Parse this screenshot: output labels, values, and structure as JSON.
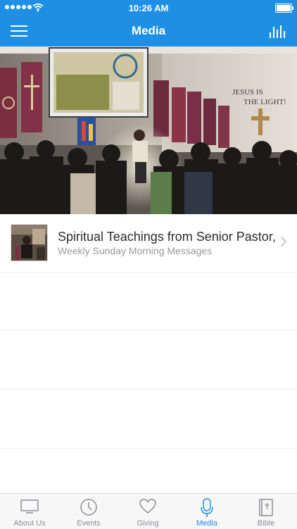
{
  "status_bar": {
    "time": "10:26 AM"
  },
  "nav": {
    "title": "Media"
  },
  "hero": {
    "banner_line1": "JESUS IS",
    "banner_line2": "THE LIGHT!",
    "pages": 2,
    "active_page": 1
  },
  "media_list": [
    {
      "title": "Spiritual Teachings from Senior Pastor, I",
      "subtitle": "Weekly Sunday Morning Messages"
    }
  ],
  "tabs": [
    {
      "label": "About Us",
      "icon": "monitor-icon",
      "active": false
    },
    {
      "label": "Events",
      "icon": "clock-icon",
      "active": false
    },
    {
      "label": "Giving",
      "icon": "heart-icon",
      "active": false
    },
    {
      "label": "Media",
      "icon": "microphone-icon",
      "active": true
    },
    {
      "label": "Bible",
      "icon": "bible-icon",
      "active": false
    }
  ],
  "colors": {
    "accent": "#1f8fe5",
    "inactive": "#8e8e93"
  }
}
